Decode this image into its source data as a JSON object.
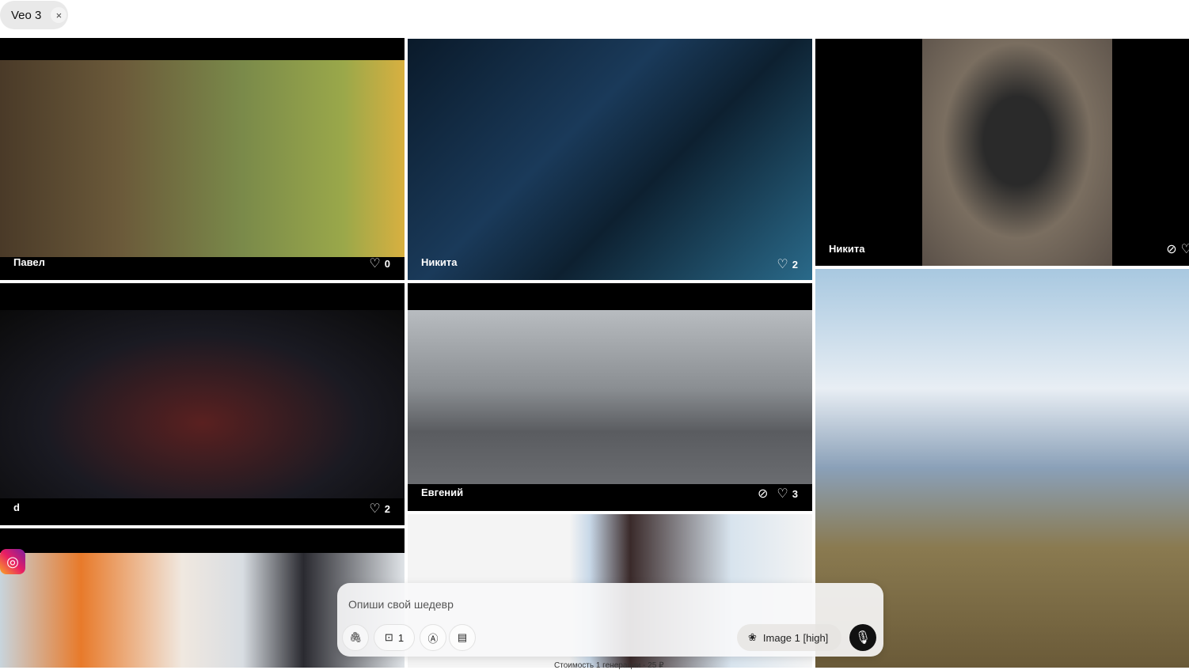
{
  "filter_chip": {
    "label": "Veo 3",
    "close": "×"
  },
  "cards": [
    {
      "author": "Павел",
      "likes": "0"
    },
    {
      "author": "Никита",
      "likes": "2"
    },
    {
      "author": "Никита"
    },
    {
      "author": "d",
      "likes": "2"
    },
    {
      "author": "Евгений",
      "likes": "3"
    }
  ],
  "prompt": {
    "placeholder": "Опиши свой шедевр",
    "count": "1",
    "model": "Image 1 [high]",
    "cost": "Стоимость 1 генерации - 25 ₽"
  }
}
